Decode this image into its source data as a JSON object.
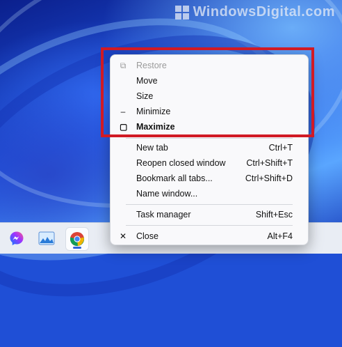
{
  "watermark": {
    "text": "WindowsDigital.com"
  },
  "menu": {
    "items": [
      {
        "id": "restore",
        "label": "Restore",
        "shortcut": "",
        "icon": "restore-icon",
        "disabled": true
      },
      {
        "id": "move",
        "label": "Move",
        "shortcut": ""
      },
      {
        "id": "size",
        "label": "Size",
        "shortcut": ""
      },
      {
        "id": "minimize",
        "label": "Minimize",
        "shortcut": "",
        "icon": "minimize-icon"
      },
      {
        "id": "maximize",
        "label": "Maximize",
        "shortcut": "",
        "icon": "maximize-icon",
        "bold": true
      },
      {
        "id": "new-tab",
        "label": "New tab",
        "shortcut": "Ctrl+T"
      },
      {
        "id": "reopen-closed-window",
        "label": "Reopen closed window",
        "shortcut": "Ctrl+Shift+T"
      },
      {
        "id": "bookmark-all-tabs",
        "label": "Bookmark all tabs...",
        "shortcut": "Ctrl+Shift+D"
      },
      {
        "id": "name-window",
        "label": "Name window...",
        "shortcut": ""
      },
      {
        "id": "task-manager",
        "label": "Task manager",
        "shortcut": "Shift+Esc"
      },
      {
        "id": "close",
        "label": "Close",
        "shortcut": "Alt+F4",
        "icon": "close-icon"
      }
    ]
  },
  "taskbar": {
    "apps": [
      {
        "name": "messenger-icon"
      },
      {
        "name": "photos-icon"
      },
      {
        "name": "chrome-icon",
        "active": true
      }
    ]
  },
  "colors": {
    "highlight": "#d11a24",
    "accent": "#2f63d8"
  }
}
